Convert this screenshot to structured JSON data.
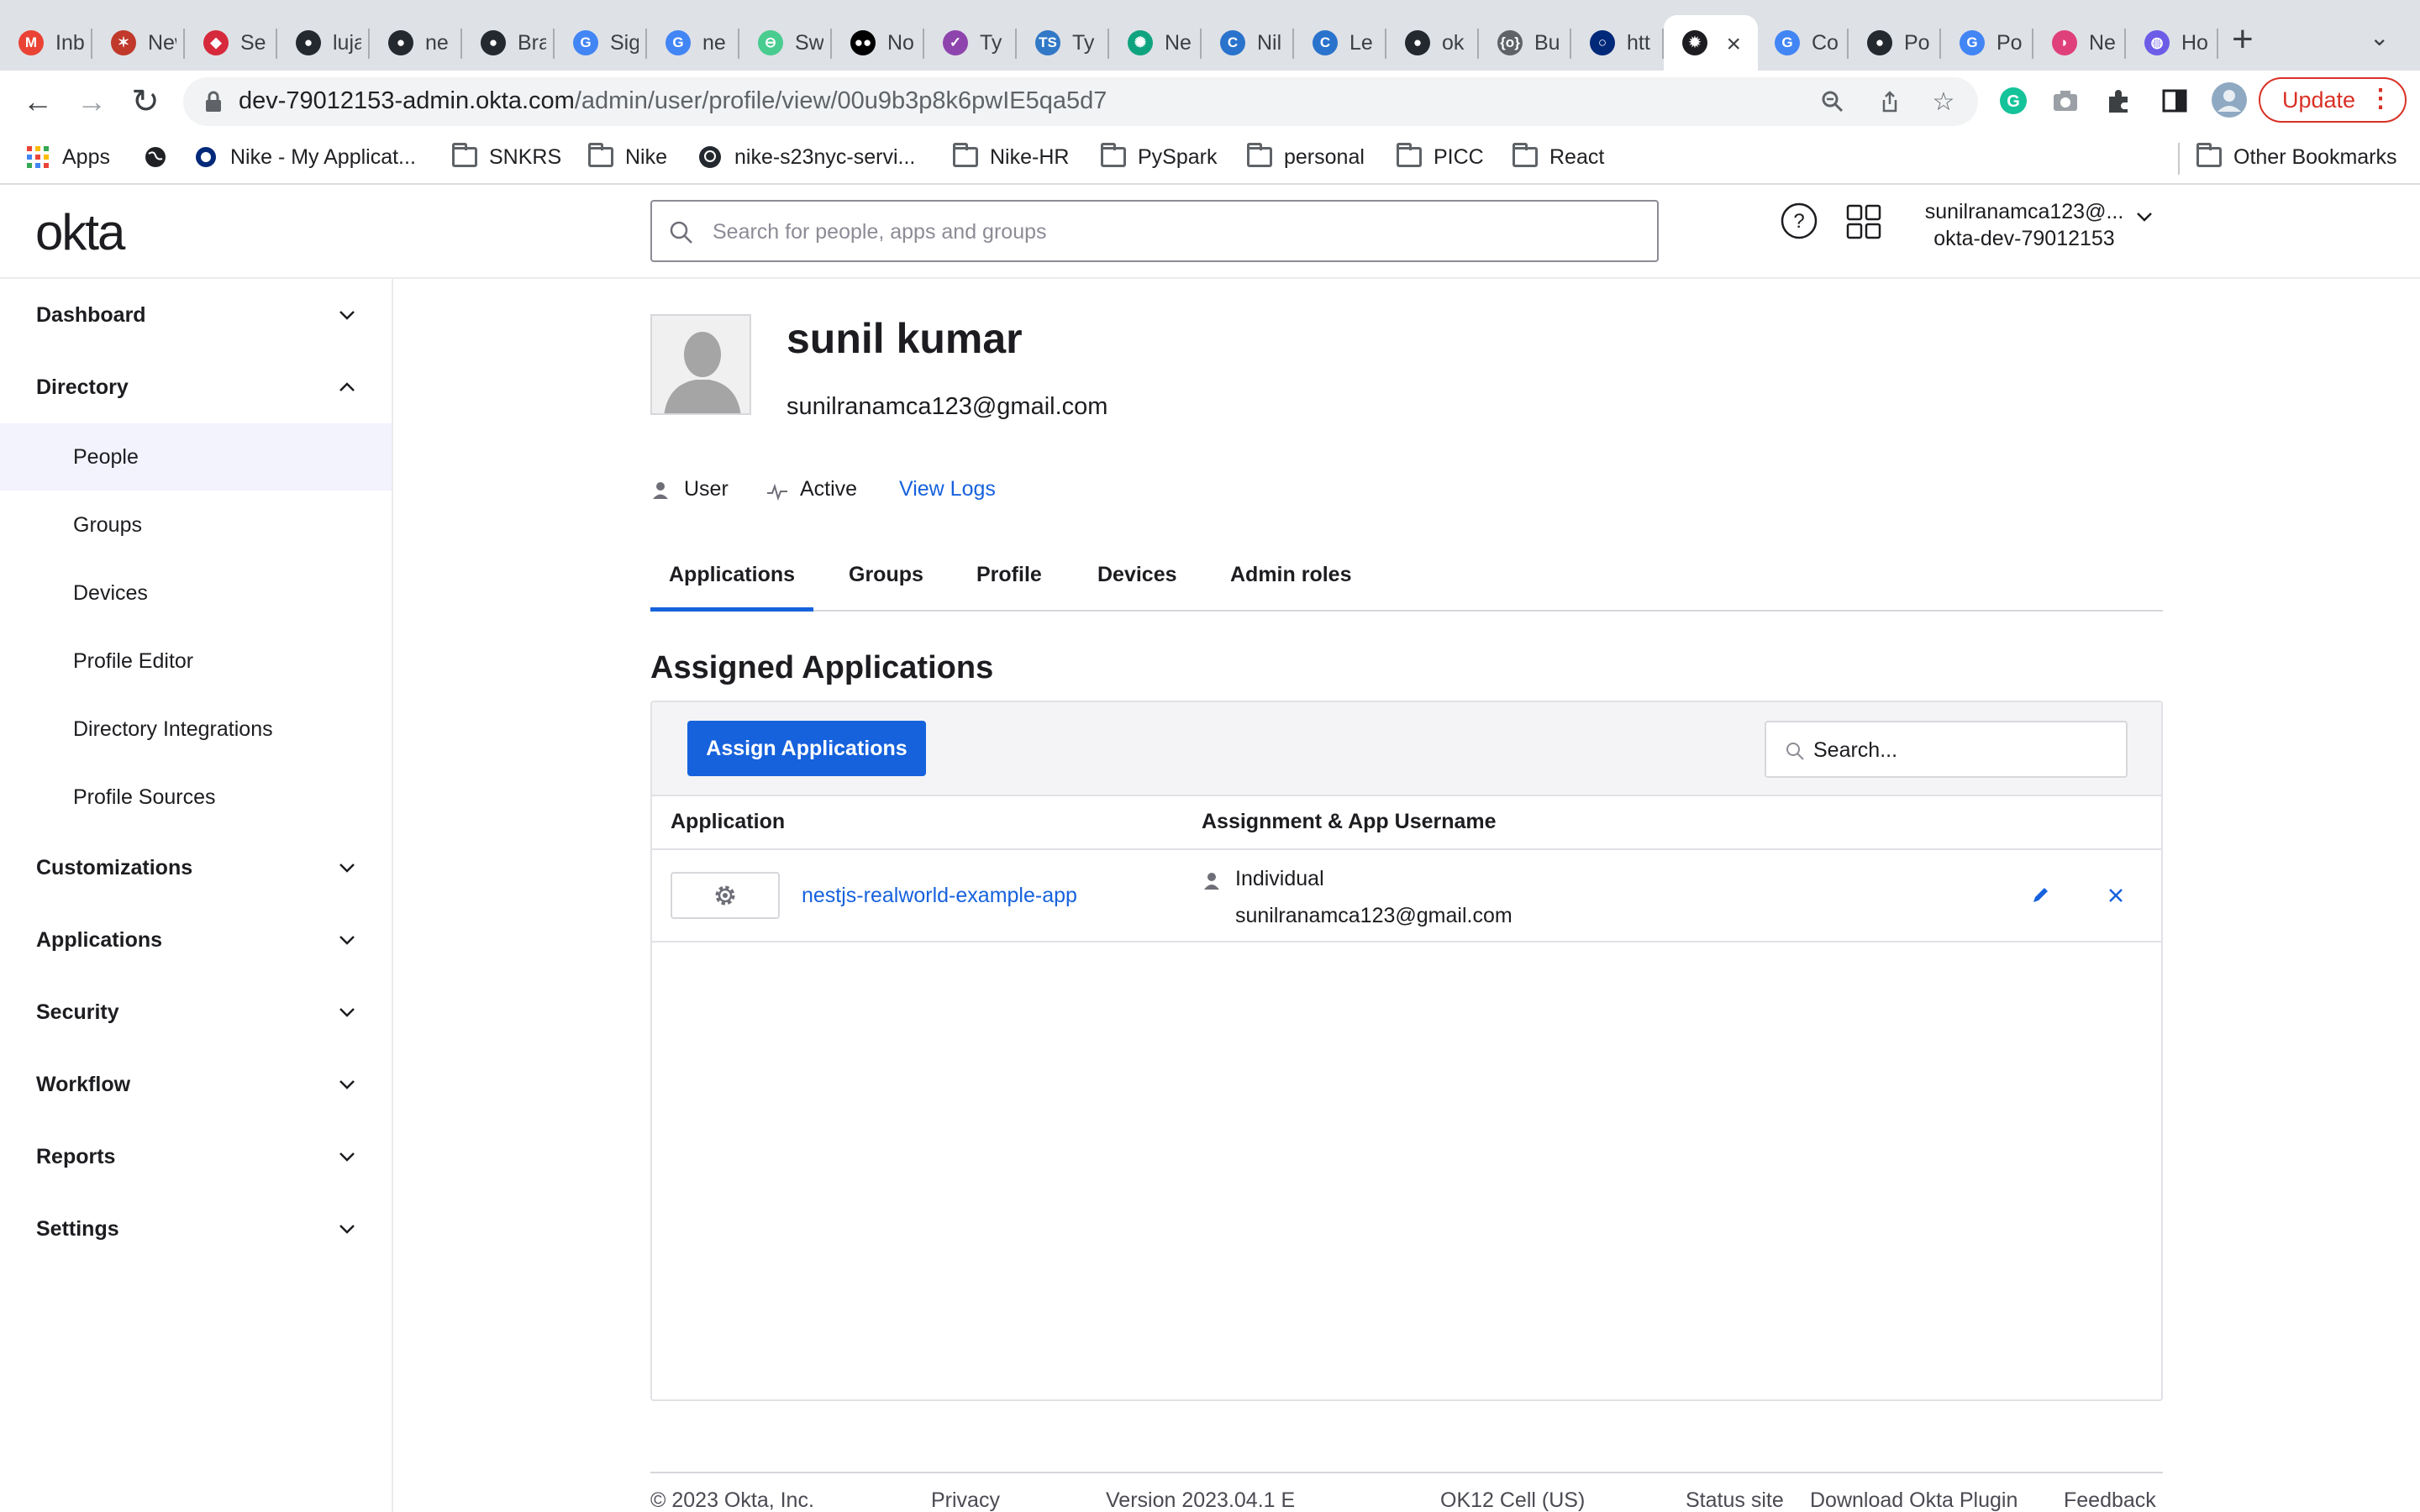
{
  "browser": {
    "tabs": [
      {
        "title": "Inbox",
        "icon": "gmail-icon",
        "color": "#ea4335",
        "glyph": "M"
      },
      {
        "title": "New",
        "icon": "spark-icon",
        "color": "#c0392b",
        "glyph": "✶"
      },
      {
        "title": "Se",
        "icon": "bird-icon",
        "color": "#d6293b",
        "glyph": "◆"
      },
      {
        "title": "luja",
        "icon": "github-icon",
        "color": "#24292f",
        "glyph": "●"
      },
      {
        "title": "ne",
        "icon": "github-icon",
        "color": "#24292f",
        "glyph": "●"
      },
      {
        "title": "Bra",
        "icon": "github-icon",
        "color": "#24292f",
        "glyph": "●"
      },
      {
        "title": "Sig",
        "icon": "google-icon",
        "color": "#4285f4",
        "glyph": "G"
      },
      {
        "title": "ne",
        "icon": "google-icon",
        "color": "#4285f4",
        "glyph": "G"
      },
      {
        "title": "Sw",
        "icon": "swagger-icon",
        "color": "#49cc90",
        "glyph": "⊖"
      },
      {
        "title": "No",
        "icon": "medium-icon",
        "color": "#000000",
        "glyph": "●●"
      },
      {
        "title": "Ty",
        "icon": "tally-icon",
        "color": "#8e44ad",
        "glyph": "✓"
      },
      {
        "title": "Ty",
        "icon": "typescript-icon",
        "color": "#3178c6",
        "glyph": "TS"
      },
      {
        "title": "Ne",
        "icon": "openai-icon",
        "color": "#10a37f",
        "glyph": "✺"
      },
      {
        "title": "Nil",
        "icon": "coursera-icon",
        "color": "#2a73cc",
        "glyph": "C"
      },
      {
        "title": "Le",
        "icon": "coursera-icon",
        "color": "#2a73cc",
        "glyph": "C"
      },
      {
        "title": "ok",
        "icon": "github-icon",
        "color": "#24292f",
        "glyph": "●"
      },
      {
        "title": "Bu",
        "icon": "brackets-icon",
        "color": "#5f6368",
        "glyph": "{o}"
      },
      {
        "title": "htt",
        "icon": "okta-circle-icon",
        "color": "#00297a",
        "glyph": "○"
      },
      {
        "title": "",
        "icon": "okta-sunburst-icon",
        "color": "#1d1d21",
        "glyph": "✹",
        "active": true
      },
      {
        "title": "Co",
        "icon": "google-icon",
        "color": "#4285f4",
        "glyph": "G"
      },
      {
        "title": "Po",
        "icon": "github-icon",
        "color": "#24292f",
        "glyph": "●"
      },
      {
        "title": "Po",
        "icon": "google-icon",
        "color": "#4285f4",
        "glyph": "G"
      },
      {
        "title": "Ne",
        "icon": "feather-icon",
        "color": "#e0407a",
        "glyph": "◗"
      },
      {
        "title": "Ho",
        "icon": "globe-purple-icon",
        "color": "#6c5ce7",
        "glyph": "◍"
      }
    ],
    "url_host": "dev-79012153-admin.okta.com",
    "url_path": "/admin/user/profile/view/00u9b3p8k6pwIE5qa5d7",
    "update_label": "Update",
    "bookmarks": [
      {
        "label": "Apps",
        "icon": "apps-grid-icon"
      },
      {
        "label": "",
        "icon": "globe-icon"
      },
      {
        "label": "Nike - My Applicat...",
        "icon": "okta-circle-icon"
      },
      {
        "label": "SNKRS",
        "icon": "folder-icon"
      },
      {
        "label": "Nike",
        "icon": "folder-icon"
      },
      {
        "label": "nike-s23nyc-servi...",
        "icon": "github-icon"
      },
      {
        "label": "Nike-HR",
        "icon": "folder-icon"
      },
      {
        "label": "PySpark",
        "icon": "folder-icon"
      },
      {
        "label": "personal",
        "icon": "folder-icon"
      },
      {
        "label": "PICC",
        "icon": "folder-icon"
      },
      {
        "label": "React",
        "icon": "folder-icon"
      }
    ],
    "other_bookmarks": "Other Bookmarks"
  },
  "header": {
    "logo": "okta",
    "search_placeholder": "Search for people, apps and groups",
    "user_email": "sunilranamca123@...",
    "org": "okta-dev-79012153"
  },
  "sidebar": {
    "sections": [
      {
        "label": "Dashboard",
        "expanded": false
      },
      {
        "label": "Directory",
        "expanded": true,
        "items": [
          "People",
          "Groups",
          "Devices",
          "Profile Editor",
          "Directory Integrations",
          "Profile Sources"
        ],
        "selected": "People"
      },
      {
        "label": "Customizations",
        "expanded": false
      },
      {
        "label": "Applications",
        "expanded": false
      },
      {
        "label": "Security",
        "expanded": false
      },
      {
        "label": "Workflow",
        "expanded": false
      },
      {
        "label": "Reports",
        "expanded": false
      },
      {
        "label": "Settings",
        "expanded": false
      }
    ]
  },
  "profile": {
    "name": "sunil kumar",
    "email": "sunilranamca123@gmail.com",
    "type": "User",
    "status": "Active",
    "view_logs": "View Logs"
  },
  "tabs": [
    "Applications",
    "Groups",
    "Profile",
    "Devices",
    "Admin roles"
  ],
  "active_tab": "Applications",
  "assigned": {
    "title": "Assigned Applications",
    "assign_button": "Assign Applications",
    "search_placeholder": "Search...",
    "columns": [
      "Application",
      "Assignment & App Username"
    ],
    "rows": [
      {
        "app": "nestjs-realworld-example-app",
        "assignment": "Individual",
        "username": "sunilranamca123@gmail.com"
      }
    ]
  },
  "footer": [
    "© 2023 Okta, Inc.",
    "Privacy",
    "Version 2023.04.1 E",
    "OK12 Cell (US)",
    "Status site",
    "Download Okta Plugin",
    "Feedback"
  ],
  "colors": {
    "accent": "#1662dd",
    "chrome_frame": "#dee1e6",
    "update": "#d93025"
  }
}
